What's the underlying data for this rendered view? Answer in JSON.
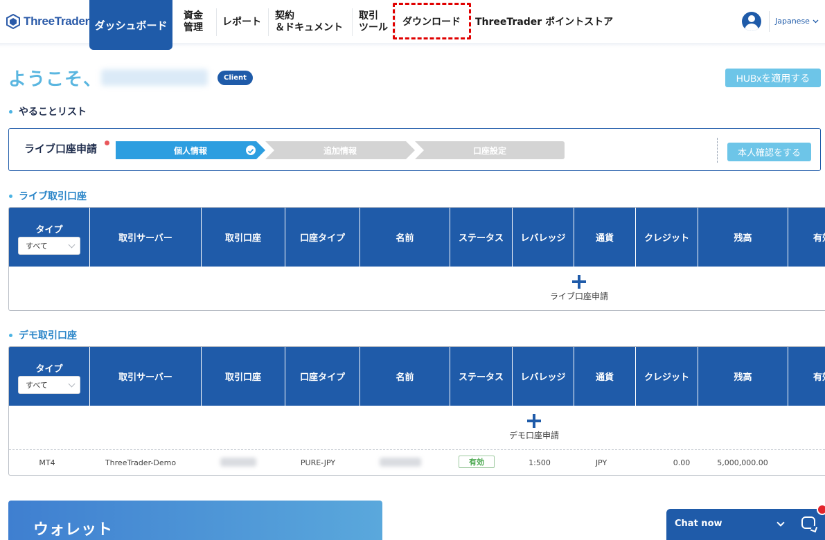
{
  "brand": {
    "name": "ThreeTrader"
  },
  "nav": {
    "dashboard": "ダッシュボード",
    "funds": [
      "資金",
      "管理"
    ],
    "report": "レポート",
    "contracts": [
      "契約",
      "＆ドキュメント"
    ],
    "tools": [
      "取引",
      "ツール"
    ],
    "download": "ダウンロード",
    "points": "ThreeTrader ポイントストア"
  },
  "language": {
    "selected": "Japanese"
  },
  "welcome": {
    "greeting": "ようこそ、",
    "badge": "Client"
  },
  "hubx_button": "HUBxを適用する",
  "todo": {
    "title": "やることリスト",
    "item_label": "ライブ口座申請",
    "steps": [
      "個人情報",
      "追加情報",
      "口座設定"
    ],
    "verify_button": "本人確認をする"
  },
  "table_headers": [
    "タイプ",
    "取引サーバー",
    "取引口座",
    "口座タイプ",
    "名前",
    "ステータス",
    "レバレッジ",
    "通貨",
    "クレジット",
    "残高",
    "有効"
  ],
  "type_filter_value": "すべて",
  "live": {
    "title": "ライブ取引口座",
    "add_label": "ライブ口座申請"
  },
  "demo": {
    "title": "デモ取引口座",
    "add_label": "デモ口座申請",
    "row": {
      "platform": "MT4",
      "server": "ThreeTrader-Demo",
      "account_type": "PURE-JPY",
      "status": "有効",
      "leverage": "1:500",
      "currency": "JPY",
      "credit": "0.00",
      "balance": "5,000,000.00"
    }
  },
  "wallet": {
    "title": "ウォレット"
  },
  "chat": {
    "label": "Chat now"
  },
  "colors": {
    "primary": "#1f5ba9",
    "accent": "#2d9ee0",
    "light_button": "#6dc5e8",
    "highlight": "#e00000"
  }
}
